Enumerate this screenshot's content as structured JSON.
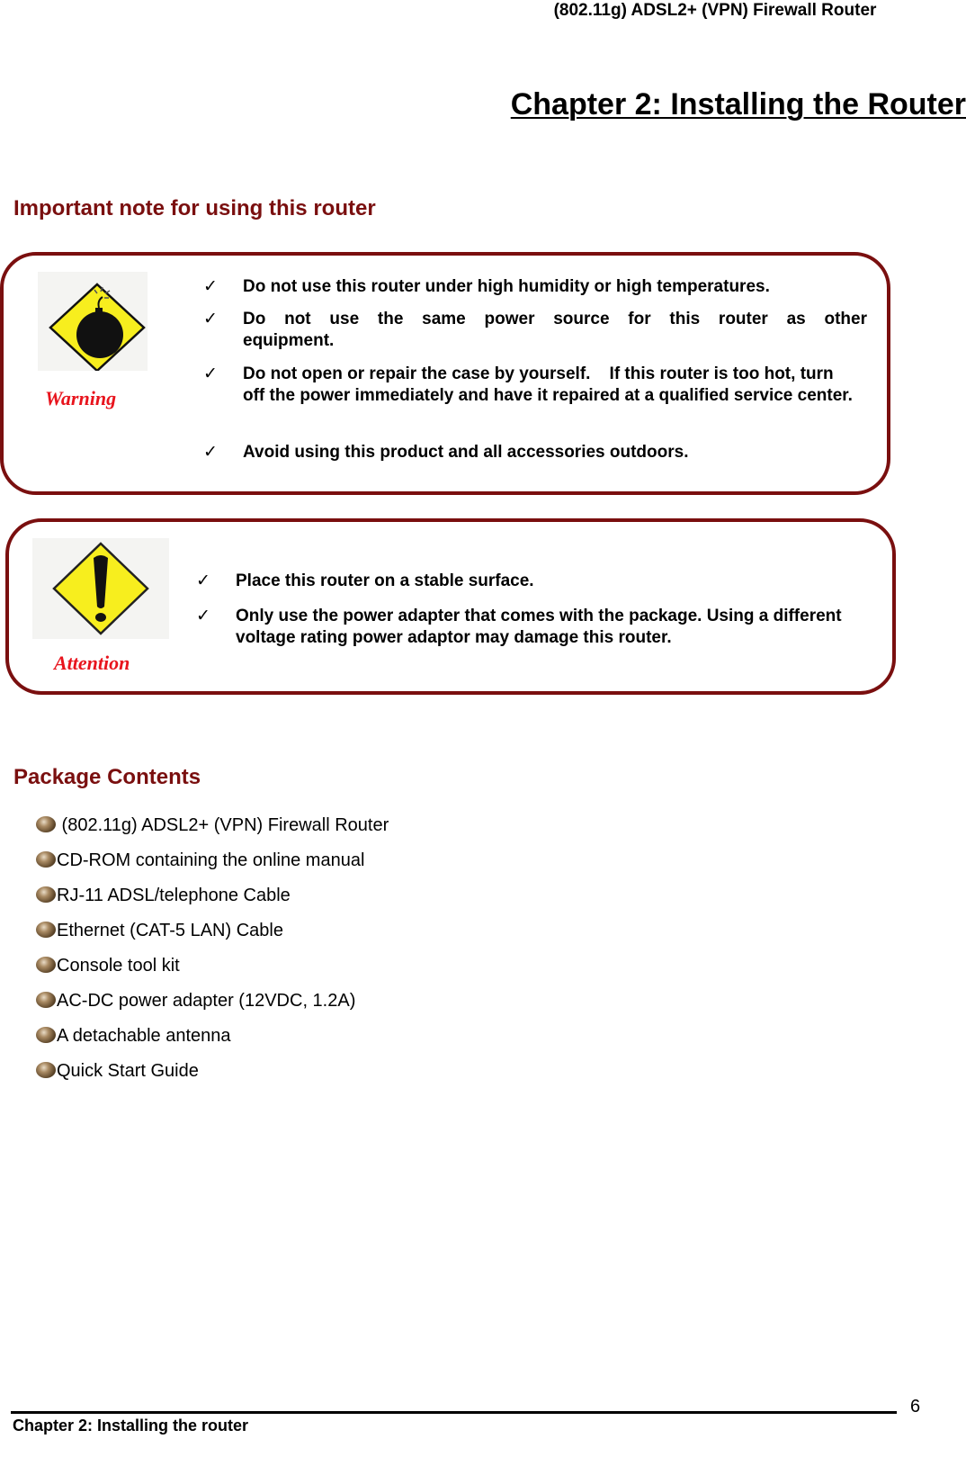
{
  "header": {
    "running_title": "(802.11g) ADSL2+ (VPN) Firewall Router",
    "chapter_title": "Chapter 2: Installing the Router"
  },
  "important_note": {
    "title": "Important note for using this router",
    "warning": {
      "icon": "bomb-warning-icon",
      "caption": "Warning",
      "items": [
        "Do not use this router under high humidity or high temperatures.",
        "Do not use the same power source for this router as other equipment.",
        "Do not open or repair the case by yourself.    If this router is too hot, turn off the power immediately and have it repaired at a qualified service center.",
        "Avoid using this product and all accessories outdoors."
      ]
    },
    "attention": {
      "icon": "exclamation-attention-icon",
      "caption": "Attention",
      "items": [
        "Place this router on a stable surface.",
        "Only use the power adapter that comes with the package. Using a different voltage rating power adaptor may damage this router."
      ]
    },
    "check_glyph": "✓"
  },
  "package_contents": {
    "title": "Package Contents",
    "items": [
      " (802.11g) ADSL2+ (VPN) Firewall Router",
      "CD-ROM containing the online manual",
      "RJ-11 ADSL/telephone Cable",
      "Ethernet (CAT-5 LAN) Cable",
      "Console tool kit",
      "AC-DC power adapter (12VDC, 1.2A)",
      "A detachable antenna",
      "Quick Start Guide"
    ]
  },
  "footer": {
    "chapter_label": "Chapter 2: Installing the router",
    "page_number": "6"
  },
  "colors": {
    "heading_dark_red": "#7a0f0f",
    "caption_red": "#e8141d",
    "sign_yellow": "#f7ee1e"
  }
}
